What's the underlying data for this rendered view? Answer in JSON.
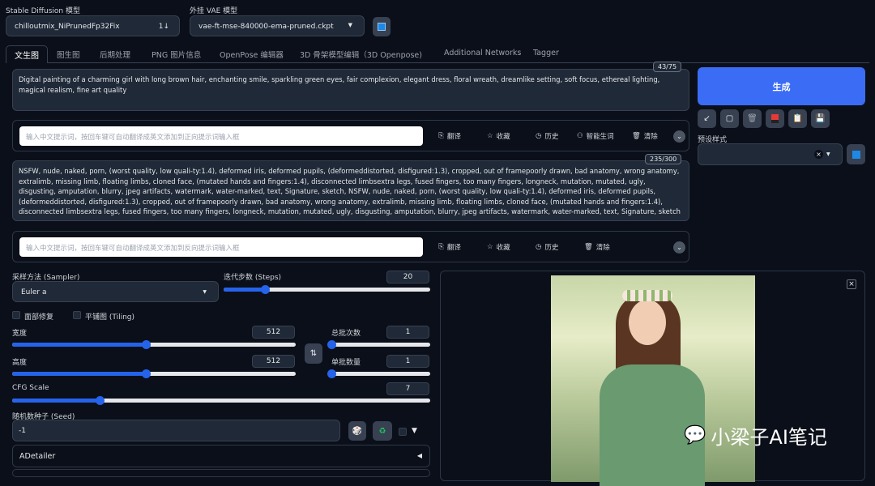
{
  "models": {
    "sd_label": "Stable Diffusion 模型",
    "sd_value": "chilloutmix_NiPrunedFp32Fix",
    "sd_icon": "1↓",
    "vae_label": "外挂 VAE 模型",
    "vae_value": "vae-ft-mse-840000-ema-pruned.ckpt"
  },
  "tabs": [
    "文生图",
    "图生图",
    "后期处理",
    "PNG 图片信息",
    "OpenPose 编辑器",
    "3D 骨架模型编辑（3D Openpose)",
    "Additional Networks",
    "Tagger"
  ],
  "prompt": {
    "text": "Digital painting of a charming girl with long brown hair, enchanting smile, sparkling green eyes, fair complexion, elegant dress, floral wreath, dreamlike setting, soft focus, ethereal lighting, magical realism, fine art quality",
    "count": "43/75"
  },
  "neg_prompt": {
    "text": "NSFW, nude, naked, porn, (worst quality, low quali-ty:1.4), deformed iris, deformed pupils, (deformeddistorted, disfigured:1.3), cropped, out of framepoorly drawn, bad anatomy, wrong anatomy, extralimb, missing limb, floating limbs, cloned face, (mutated hands and fingers:1.4), disconnected limbsextra legs, fused fingers, too many fingers, longneck, mutation, mutated, ugly, disgusting, amputation, blurry, jpeg artifacts, watermark, water-marked, text, Signature, sketch, NSFW, nude, naked, porn, (worst quality, low quali-ty:1.4), deformed iris, deformed pupils, (deformeddistorted, disfigured:1.3), cropped, out of framepoorly drawn, bad anatomy, wrong anatomy, extralimb, missing limb, floating limbs, cloned face, (mutated hands and fingers:1.4), disconnected limbsextra legs, fused fingers, too many fingers, longneck, mutation, mutated, ugly, disgusting, amputation, blurry, jpeg artifacts, watermark, water-marked, text, Signature, sketch",
    "count": "235/300"
  },
  "helper1": {
    "placeholder": "输入中文提示词，按回车键可自动翻译成英文添加到正向提示词输入框",
    "translate": "翻译",
    "favorite": "收藏",
    "history": "历史",
    "smart": "智能生词",
    "clear": "清除"
  },
  "helper2": {
    "placeholder": "输入中文提示词，按回车键可自动翻译成英文添加到反向提示词输入框",
    "translate": "翻译",
    "favorite": "收藏",
    "history": "历史",
    "clear": "清除"
  },
  "generate": "生成",
  "styles_label": "预设样式",
  "sampler": {
    "label": "采样方法 (Sampler)",
    "value": "Euler a"
  },
  "steps": {
    "label": "迭代步数 (Steps)",
    "value": "20",
    "fraction": 0.2
  },
  "face_restore": "面部修复",
  "tiling": "平铺图 (Tiling)",
  "width": {
    "label": "宽度",
    "value": "512",
    "fraction": 0.47
  },
  "height": {
    "label": "高度",
    "value": "512",
    "fraction": 0.47
  },
  "batch_count": {
    "label": "总批次数",
    "value": "1",
    "fraction": 0
  },
  "batch_size": {
    "label": "单批数量",
    "value": "1",
    "fraction": 0
  },
  "cfg": {
    "label": "CFG Scale",
    "value": "7",
    "fraction": 0.21
  },
  "seed": {
    "label": "随机数种子 (Seed)",
    "value": "-1"
  },
  "adetailer": "ADetailer",
  "watermark": "小梁子AI笔记"
}
